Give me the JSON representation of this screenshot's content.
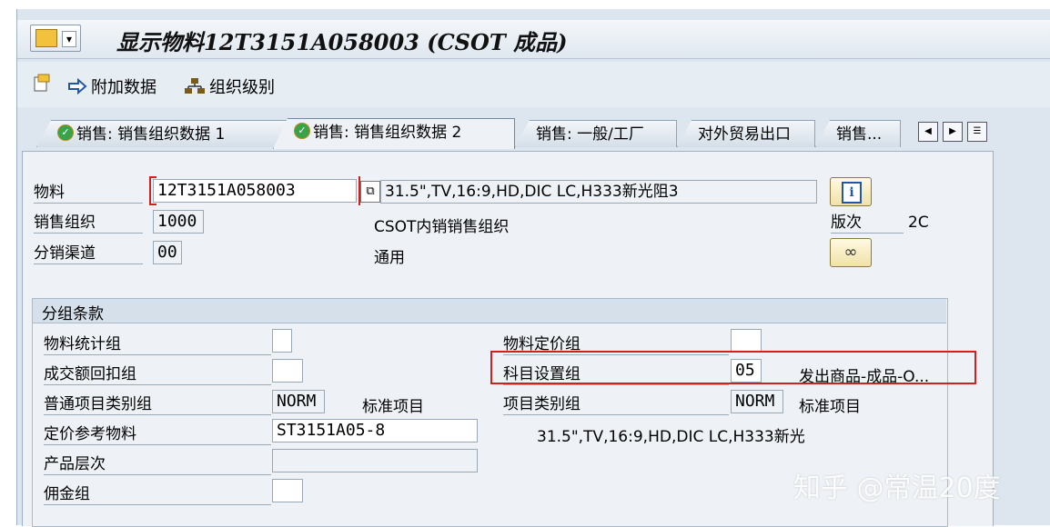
{
  "window": {
    "title": "显示物料12T3151A058003 (CSOT 成品)"
  },
  "toolbar": {
    "additional_data": "附加数据",
    "org_levels": "组织级别"
  },
  "tabs": [
    {
      "label": "销售: 销售组织数据 1"
    },
    {
      "label": "销售: 销售组织数据 2"
    },
    {
      "label": "销售: 一般/工厂"
    },
    {
      "label": "对外贸易出口"
    },
    {
      "label": "销售..."
    }
  ],
  "header": {
    "material_label": "物料",
    "material_value": "12T3151A058003",
    "material_desc": "31.5\",TV,16:9,HD,DIC LC,H333新光阻3",
    "sales_org_label": "销售组织",
    "sales_org_value": "1000",
    "sales_org_desc": "CSOT内销销售组织",
    "dist_channel_label": "分销渠道",
    "dist_channel_value": "00",
    "dist_channel_desc": "通用",
    "version_label": "版次",
    "version_value": "2C"
  },
  "grouping": {
    "title": "分组条款",
    "mat_stat_group_label": "物料统计组",
    "mat_stat_group_value": "",
    "volume_rebate_label": "成交额回扣组",
    "volume_rebate_value": "",
    "gen_item_cat_label": "普通项目类别组",
    "gen_item_cat_value": "NORM",
    "gen_item_cat_desc": "标准项目",
    "pricing_ref_label": "定价参考物料",
    "pricing_ref_value": "ST3151A05-8",
    "pricing_ref_desc": "31.5\",TV,16:9,HD,DIC LC,H333新光",
    "prod_hier_label": "产品层次",
    "prod_hier_value": "",
    "commission_label": "佣金组",
    "commission_value": "",
    "mat_price_group_label": "物料定价组",
    "mat_price_group_value": "",
    "acct_assign_label": "科目设置组",
    "acct_assign_value": "05",
    "acct_assign_desc": "发出商品-成品-O...",
    "item_cat_label": "项目类别组",
    "item_cat_value": "NORM",
    "item_cat_desc": "标准项目"
  },
  "watermark": "知乎 @常温20度",
  "colors": {
    "highlight": "#d21f1f",
    "check": "#3aa24a"
  }
}
